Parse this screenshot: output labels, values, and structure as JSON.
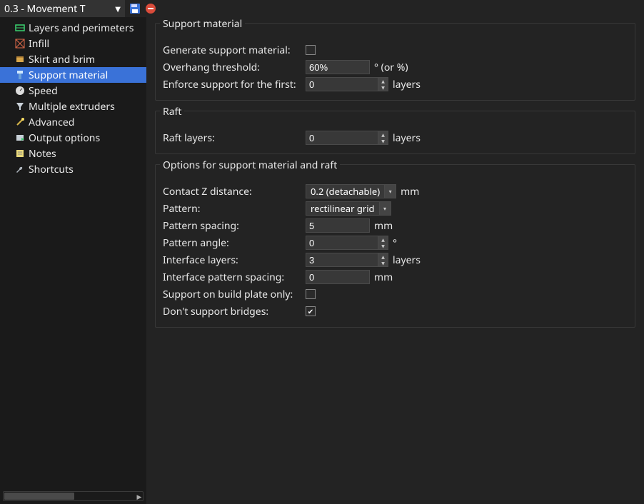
{
  "profile": {
    "name": "0.3 - Movement T"
  },
  "sidebar": {
    "items": [
      {
        "label": "Layers and perimeters",
        "icon": "layers"
      },
      {
        "label": "Infill",
        "icon": "infill"
      },
      {
        "label": "Skirt and brim",
        "icon": "skirt"
      },
      {
        "label": "Support material",
        "icon": "support",
        "selected": true
      },
      {
        "label": "Speed",
        "icon": "speed"
      },
      {
        "label": "Multiple extruders",
        "icon": "funnel"
      },
      {
        "label": "Advanced",
        "icon": "wand"
      },
      {
        "label": "Output options",
        "icon": "output"
      },
      {
        "label": "Notes",
        "icon": "notes"
      },
      {
        "label": "Shortcuts",
        "icon": "wrench"
      }
    ]
  },
  "groups": {
    "support": {
      "title": "Support material",
      "generate_label": "Generate support material:",
      "generate_value": false,
      "overhang_label": "Overhang threshold:",
      "overhang_value": "60%",
      "overhang_suffix": "° (or %)",
      "enforce_label": "Enforce support for the first:",
      "enforce_value": "0",
      "enforce_suffix": "layers"
    },
    "raft": {
      "title": "Raft",
      "layers_label": "Raft layers:",
      "layers_value": "0",
      "layers_suffix": "layers"
    },
    "options": {
      "title": "Options for support material and raft",
      "contact_label": "Contact Z distance:",
      "contact_value": "0.2 (detachable)",
      "contact_suffix": "mm",
      "pattern_label": "Pattern:",
      "pattern_value": "rectilinear grid",
      "spacing_label": "Pattern spacing:",
      "spacing_value": "5",
      "spacing_suffix": "mm",
      "angle_label": "Pattern angle:",
      "angle_value": "0",
      "angle_suffix": "°",
      "iflayers_label": "Interface layers:",
      "iflayers_value": "3",
      "iflayers_suffix": "layers",
      "ifspacing_label": "Interface pattern spacing:",
      "ifspacing_value": "0",
      "ifspacing_suffix": "mm",
      "plateonly_label": "Support on build plate only:",
      "plateonly_value": false,
      "bridges_label": "Don't support bridges:",
      "bridges_value": true
    }
  }
}
